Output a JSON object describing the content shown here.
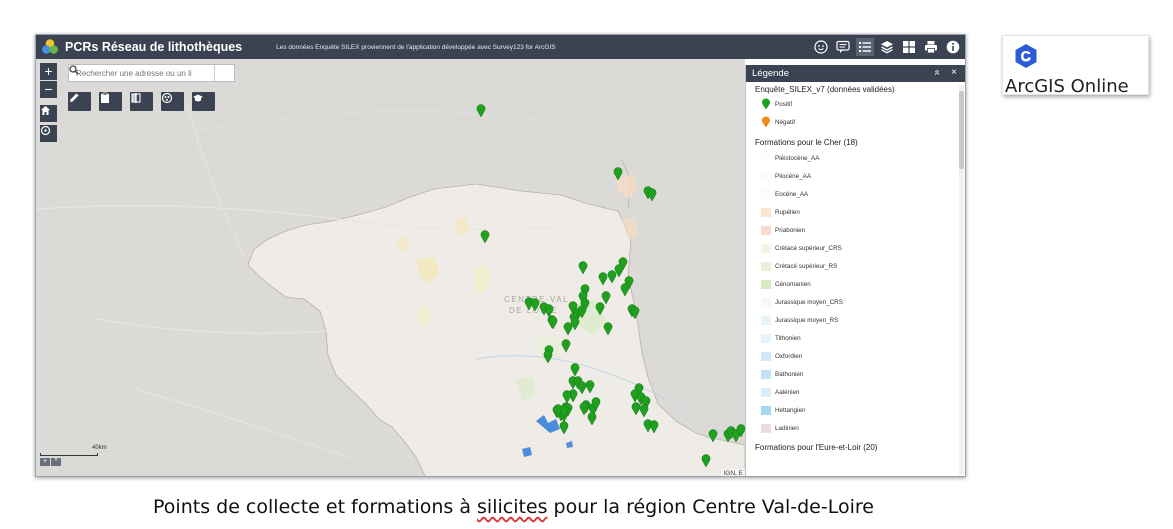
{
  "header": {
    "title": "PCRs Réseau de lithothèques",
    "subtitle": "Les données Enquête SILEX proviennent de l'application développée avec Survey123 for ArcGIS",
    "tools": [
      {
        "icon": "smiley-icon"
      },
      {
        "icon": "speech-bubble-icon"
      },
      {
        "icon": "list-icon"
      },
      {
        "icon": "layers-icon"
      },
      {
        "icon": "grid-icon"
      },
      {
        "icon": "print-icon"
      },
      {
        "icon": "info-icon"
      }
    ]
  },
  "map": {
    "zoom_in": "+",
    "zoom_out": "−",
    "search_placeholder": "Rechercher une adresse ou un li",
    "region_label_line1": "CENTRE-VAL",
    "region_label_line2": "DE LOIRE",
    "scale_label": "40km",
    "attribution": "IGN, E",
    "overview": [
      "+",
      "^"
    ]
  },
  "legend": {
    "title": "Légende",
    "collapse_symbol": "»",
    "close_symbol": "×",
    "layer1_title": "Enquête_SILEX_v7 (données validées)",
    "layer1_items": [
      {
        "label": "Positif",
        "color": "#1fa01f"
      },
      {
        "label": "Négatif",
        "color": "#f08a1c"
      }
    ],
    "layer2_title": "Formations pour le Cher (18)",
    "layer2_items": [
      {
        "label": "Pléistocène_AA",
        "color": "#fdfdfc"
      },
      {
        "label": "Pliocène_AA",
        "color": "#fdfcfb"
      },
      {
        "label": "Eocène_AA",
        "color": "#fcfbf9"
      },
      {
        "label": "Rupélien",
        "color": "#fde6cd"
      },
      {
        "label": "Priabonien",
        "color": "#fbdad0"
      },
      {
        "label": "Crétacé supérieur_CRS",
        "color": "#f3f4e6"
      },
      {
        "label": "Crétacé supérieur_RS",
        "color": "#eaf1d9"
      },
      {
        "label": "Cénomanien",
        "color": "#d7ebc3"
      },
      {
        "label": "Jurassique moyen_CRS",
        "color": "#f6f9fc"
      },
      {
        "label": "Jurassique moyen_RS",
        "color": "#e9f4fa"
      },
      {
        "label": "Tithonien",
        "color": "#e4f2fb"
      },
      {
        "label": "Oxfordien",
        "color": "#cfe9f8"
      },
      {
        "label": "Bathonien",
        "color": "#c0e4f6"
      },
      {
        "label": "Aalénien",
        "color": "#d9eef9"
      },
      {
        "label": "Hettangien",
        "color": "#a6d9f1"
      },
      {
        "label": "Ladinien",
        "color": "#eed9e6"
      }
    ],
    "layer3_title": "Formations pour l'Eure-et-Loir (20)"
  },
  "badge": {
    "text": "ArcGIS Online",
    "accent": "#2c5bd8"
  },
  "caption": {
    "before": "Points de collecte et formations à ",
    "marked": "silicites",
    "after": " pour la région Centre Val-de-Loire"
  },
  "colors": {
    "header_bg": "#3b4352",
    "map_bg": "#dcdad6",
    "region_fill": "#efebe6",
    "pin_positive": "#1fa01f",
    "water": "#2b7bd6"
  }
}
